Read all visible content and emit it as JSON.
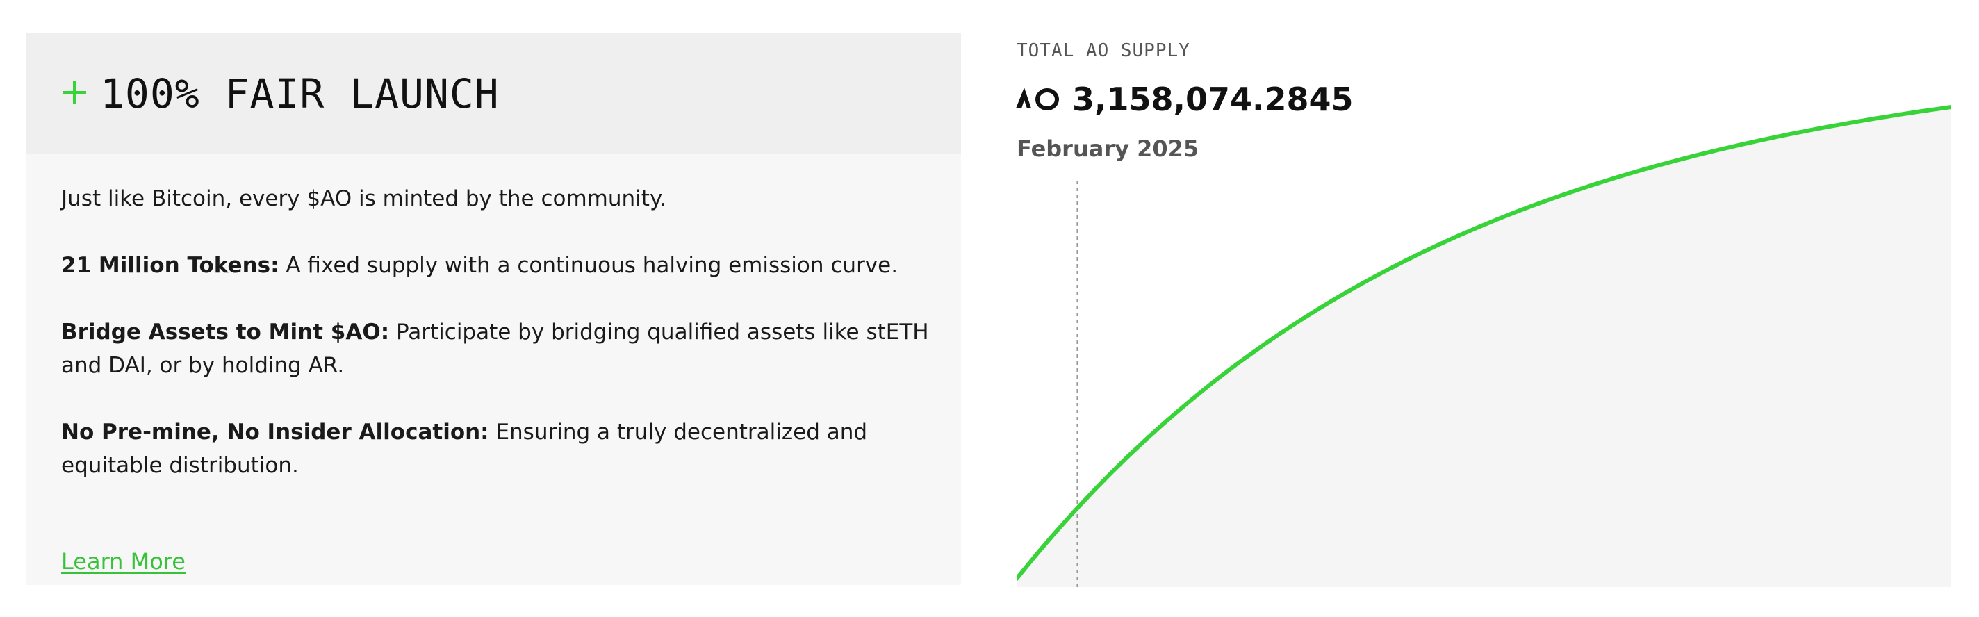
{
  "card": {
    "title": "100% FAIR LAUNCH",
    "intro": "Just like Bitcoin, every $AO is minted by the community.",
    "points": [
      {
        "bold": "21 Million Tokens:",
        "text": " A fixed supply with a continuous halving emission curve."
      },
      {
        "bold": "Bridge Assets to Mint $AO:",
        "text": " Participate by bridging qualified assets like stETH and DAI, or by holding AR."
      },
      {
        "bold": "No Pre-mine, No Insider Allocation:",
        "text": " Ensuring a truly decentralized and equitable distribution."
      }
    ],
    "learn_more": "Learn More",
    "accent_color": "#37d339"
  },
  "supply": {
    "label": "TOTAL AO SUPPLY",
    "value": "3,158,074.2845",
    "date": "February 2025",
    "logo_icon": "ao-logo-icon"
  },
  "chart_data": {
    "type": "area",
    "curve": "halving-emission",
    "marker_fraction": 0.065,
    "line_color": "#37d339",
    "fill_color": "#f5f5f5",
    "marker_style": "dashed-vertical"
  }
}
